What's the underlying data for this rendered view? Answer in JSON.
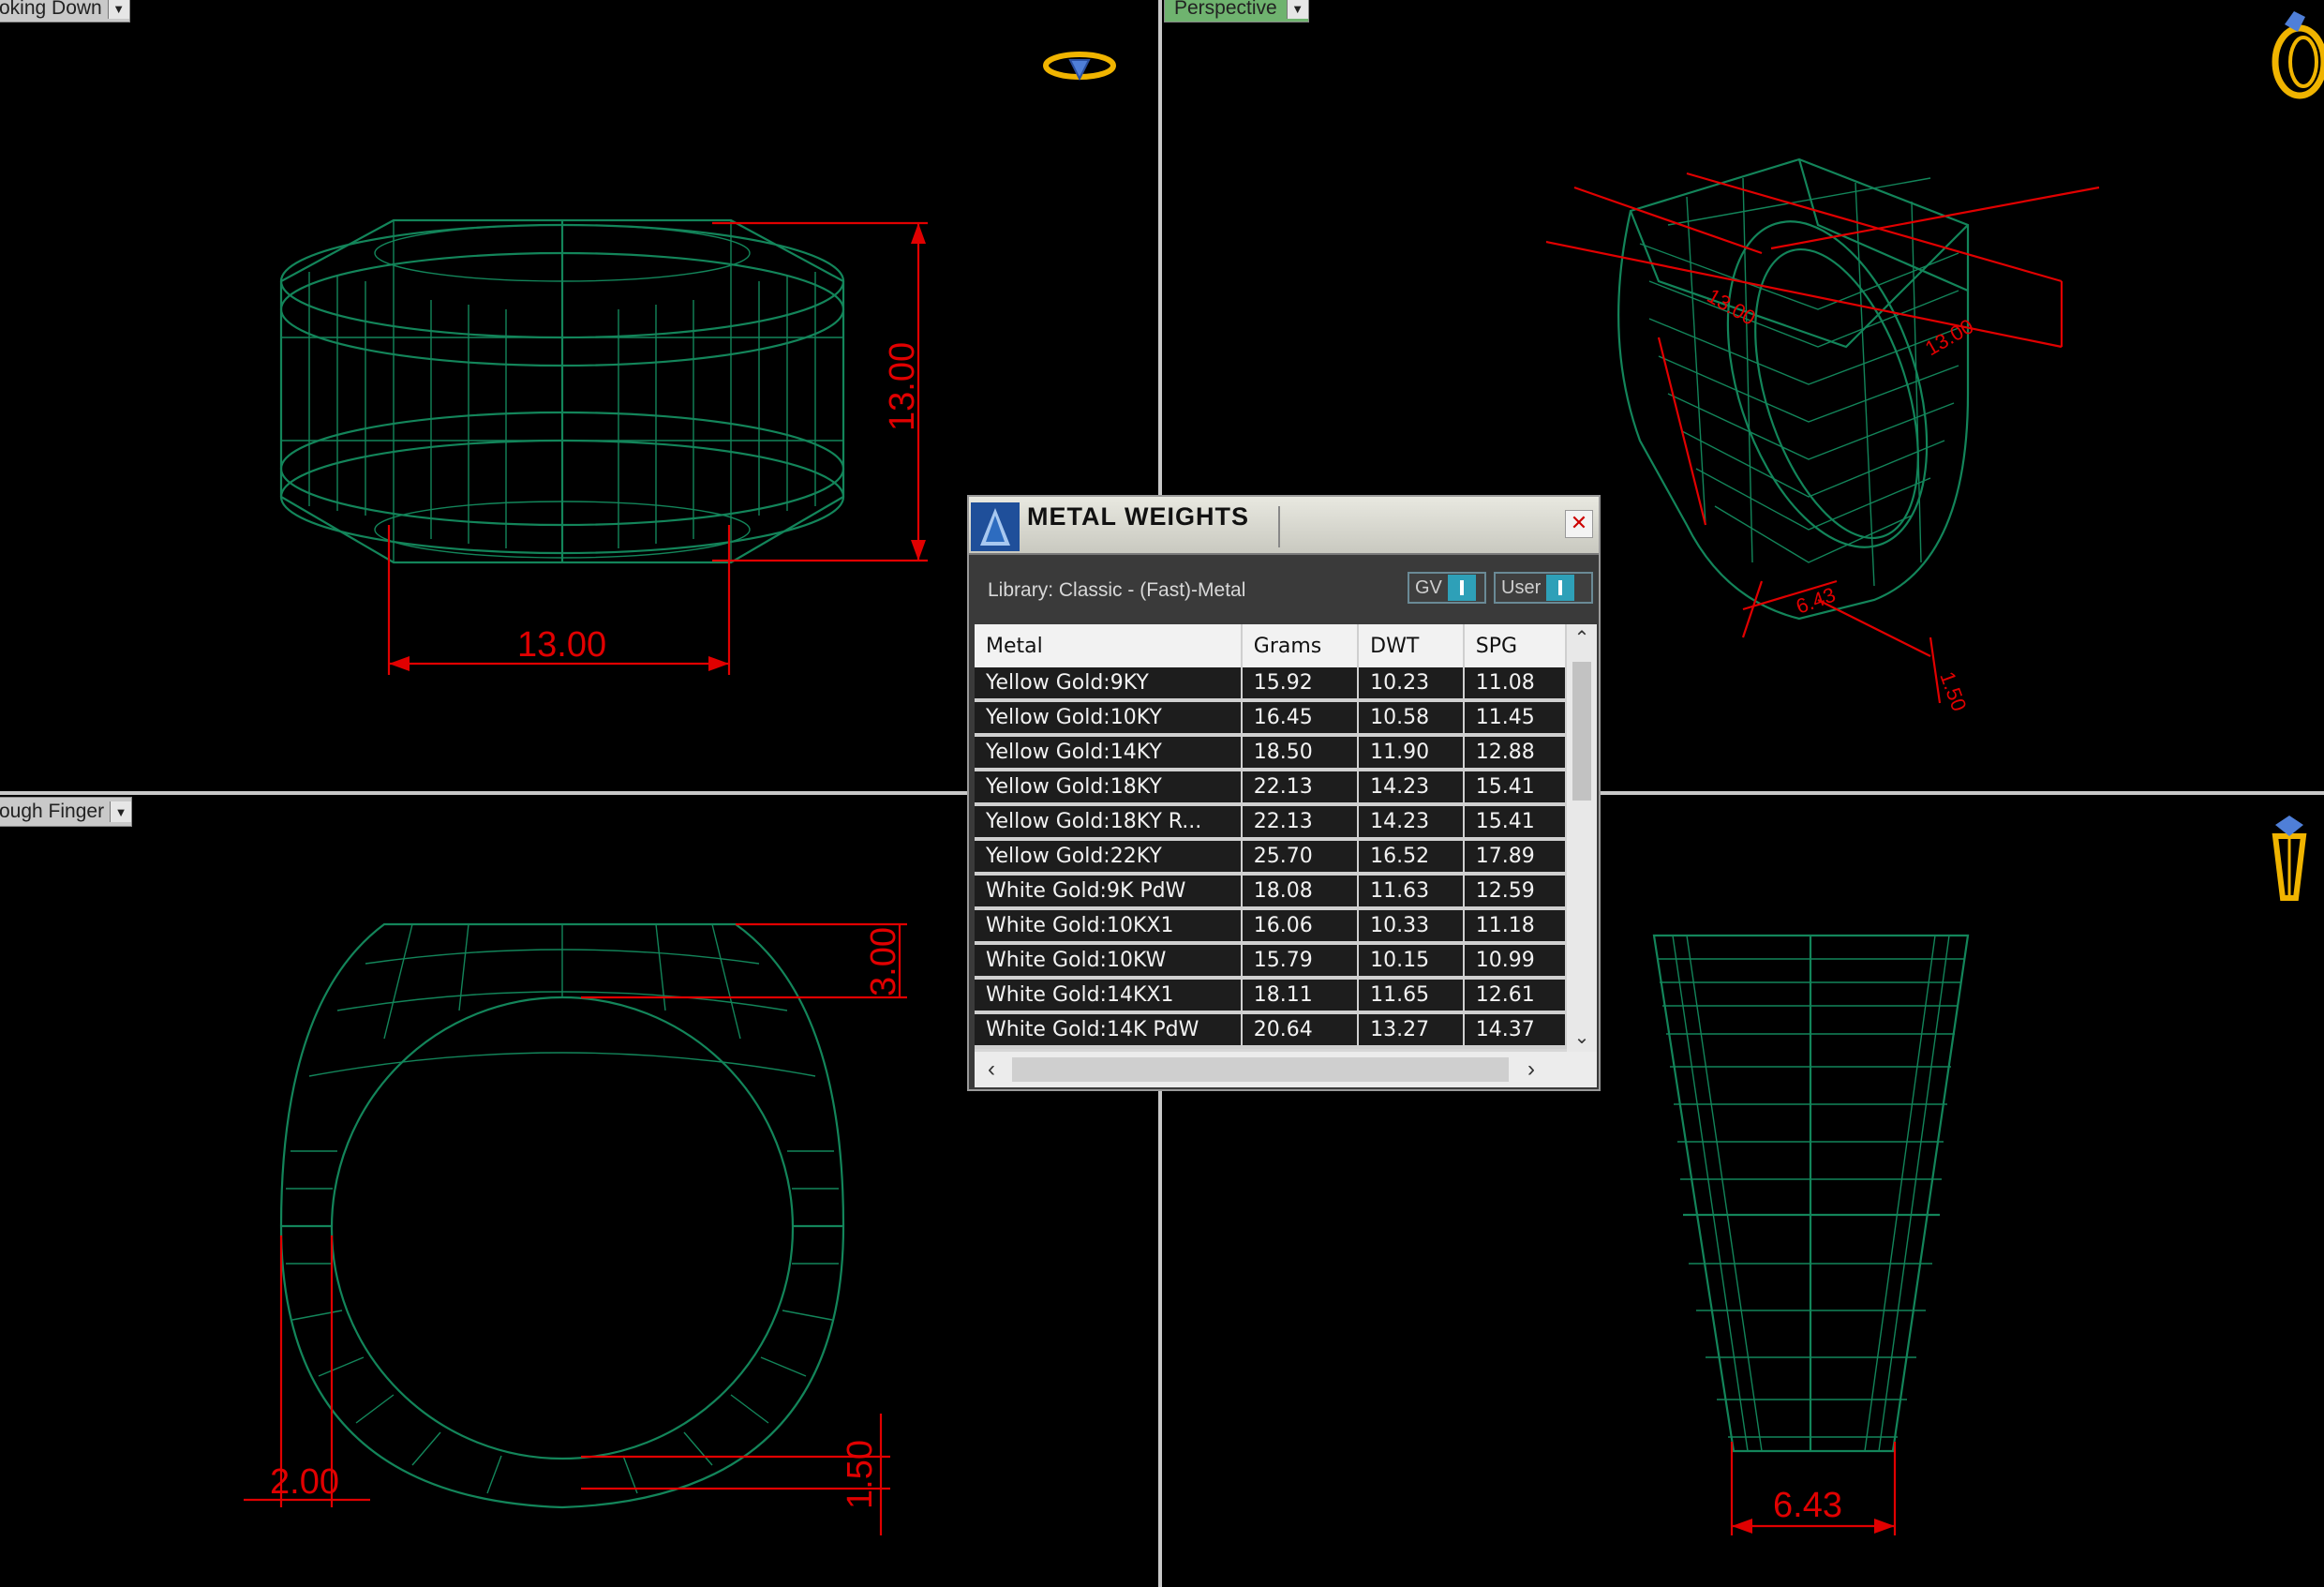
{
  "viewports": {
    "top_left": {
      "tab_label": "oking Down"
    },
    "top_right": {
      "tab_label": "Perspective"
    },
    "bottom_left": {
      "tab_label": "ough Finger"
    },
    "bottom_right": {
      "tab_label": ""
    }
  },
  "dimensions": {
    "top_view_width": "13.00",
    "top_view_height": "13.00",
    "front_top_thickness": "3.00",
    "front_side_width": "2.00",
    "front_bottom_thickness": "1.50",
    "side_bottom_width": "6.43"
  },
  "dialog": {
    "title": "METAL WEIGHTS",
    "close_symbol": "✕",
    "library_label": "Library: Classic - (Fast)-Metal",
    "toggle_gv": "GV",
    "toggle_user": "User",
    "columns": [
      "Metal",
      "Grams",
      "DWT",
      "SPG"
    ],
    "rows": [
      [
        "Yellow Gold:9KY",
        "15.92",
        "10.23",
        "11.08"
      ],
      [
        "Yellow Gold:10KY",
        "16.45",
        "10.58",
        "11.45"
      ],
      [
        "Yellow Gold:14KY",
        "18.50",
        "11.90",
        "12.88"
      ],
      [
        "Yellow Gold:18KY",
        "22.13",
        "14.23",
        "15.41"
      ],
      [
        "Yellow Gold:18KY R...",
        "22.13",
        "14.23",
        "15.41"
      ],
      [
        "Yellow Gold:22KY",
        "25.70",
        "16.52",
        "17.89"
      ],
      [
        "White Gold:9K PdW",
        "18.08",
        "11.63",
        "12.59"
      ],
      [
        "White Gold:10KX1",
        "16.06",
        "10.33",
        "11.18"
      ],
      [
        "White Gold:10KW",
        "15.79",
        "10.15",
        "10.99"
      ],
      [
        "White Gold:14KX1",
        "18.11",
        "11.65",
        "12.61"
      ],
      [
        "White Gold:14K PdW",
        "20.64",
        "13.27",
        "14.37"
      ]
    ]
  },
  "colors": {
    "wireframe": "#13855a",
    "dimension": "#e10000",
    "icon": "#f0b400"
  }
}
